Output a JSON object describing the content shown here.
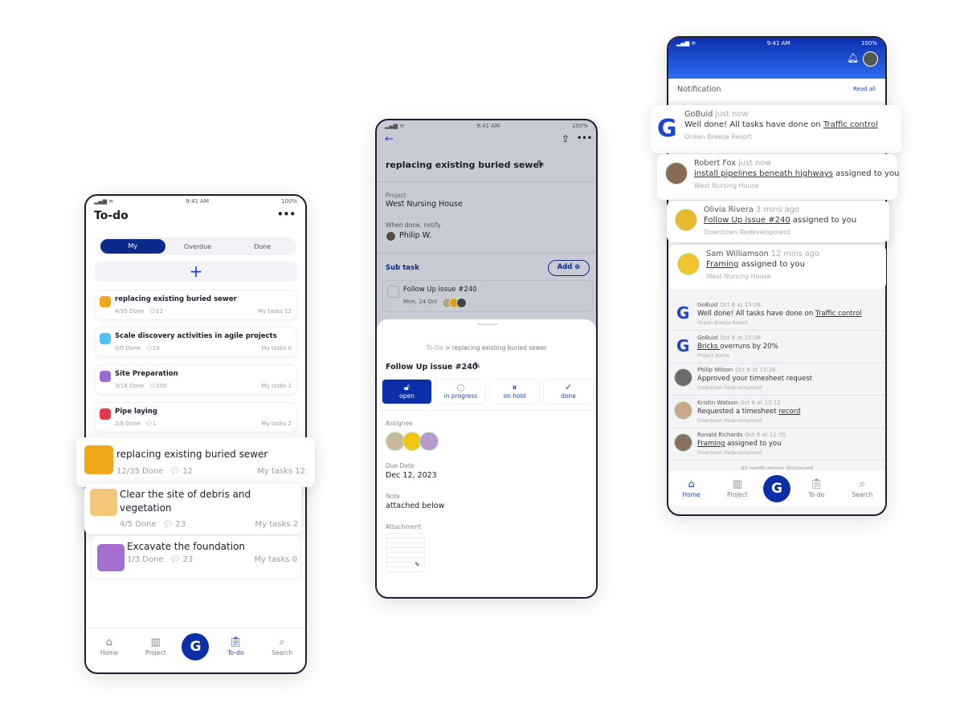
{
  "colors": {
    "primary": "#0a2fa8",
    "accent": "#1f3fd1",
    "header_gradient": [
      "#0d2fb0",
      "#2d6cf0"
    ]
  },
  "status_bar": {
    "time": "9:41 AM",
    "battery": "100%"
  },
  "todo": {
    "title": "To-do",
    "more_icon": "more-horizontal-icon",
    "tabs": [
      "My",
      "Overdue",
      "Done"
    ],
    "add_label": "+",
    "items": [
      {
        "title": "replacing existing buried sewer",
        "done": "4/35 Done",
        "comments": "12",
        "my_tasks": "My tasks 12",
        "icon_color": "#f0a71a"
      },
      {
        "title": "Scale discovery activities in agile projects",
        "done": "0/0 Done",
        "comments": "23",
        "my_tasks": "My tasks 0",
        "icon_color": "#4fc3f7"
      },
      {
        "title": "Site Preparation",
        "done": "3/18 Done",
        "comments": "100",
        "my_tasks": "My tasks 1",
        "icon_color": "#9b6bd6"
      },
      {
        "title": "Pipe laying",
        "done": "2/8 Done",
        "comments": "1",
        "my_tasks": "My tasks 2",
        "icon_color": "#e5384b"
      }
    ],
    "highlight_items": [
      {
        "title": "replacing existing buried sewer",
        "done": "12/35 Done",
        "comments": "12",
        "my_tasks": "My tasks 12",
        "icon_color": "#f0a71a"
      },
      {
        "title": "Clear the site of debris and vegetation",
        "done": "4/5 Done",
        "comments": "23",
        "my_tasks": "My tasks 2",
        "icon_color": "#f2c77a"
      },
      {
        "title": "Excavate the foundation",
        "done": "1/3 Done",
        "comments": "23",
        "my_tasks": "My tasks 0",
        "icon_color": "#a56fd0"
      }
    ],
    "nav": [
      {
        "label": "Home",
        "icon": "home-icon"
      },
      {
        "label": "Project",
        "icon": "project-icon"
      },
      {
        "label": "G",
        "icon": "gobuild-logo"
      },
      {
        "label": "To-do",
        "icon": "todo-clipboard-icon",
        "active": true
      },
      {
        "label": "Search",
        "icon": "search-icon"
      }
    ]
  },
  "detail": {
    "title": "replacing existing buried sewer",
    "project_label": "Project",
    "project": "West Nursing House",
    "notify_label": "When done, notify",
    "notify_person": "Philip W.",
    "subtask_label": "Sub task",
    "add_label": "Add",
    "subtask": {
      "title": "Follow Up issue #240",
      "date": "Mon, 24 Oct"
    },
    "sheet": {
      "breadcrumb_root": "To-Do",
      "breadcrumb_sep": ">",
      "breadcrumb_current": "replacing existing buried sewer",
      "title": "Follow Up issue #240",
      "statuses": [
        {
          "label": "open",
          "icon": "lock-icon",
          "active": true
        },
        {
          "label": "in progress",
          "icon": "progress-icon"
        },
        {
          "label": "on hold",
          "icon": "pause-icon"
        },
        {
          "label": "done",
          "icon": "check-icon"
        }
      ],
      "assignee_label": "Assignee",
      "due_label": "Due Date",
      "due": "Dec 12, 2023",
      "note_label": "Note",
      "note": "attached below",
      "attachment_label": "Attachment"
    }
  },
  "notifications": {
    "header": "Notification",
    "read_all": "Read all",
    "floating": [
      {
        "who": "GoBuid",
        "time": "just now",
        "pre": "Well done! All tasks have done on ",
        "link": "Traffic control",
        "post": "",
        "project": "Ocean Breeze Resort",
        "logo": true
      },
      {
        "who": "Robert Fox",
        "time": "just now",
        "pre": "",
        "link": "install pipelines beneath highways",
        "post": " assigned to you",
        "project": "West Nursing House",
        "avatar": "#8a6a52"
      },
      {
        "who": "Olivia Rivera",
        "time": "3 mins ago",
        "pre": "",
        "link": "Follow Up issue #240",
        "post": " assigned to you",
        "project": "Downtown Redevelopment",
        "avatar": "#e8b92e"
      },
      {
        "who": "Sam Williamson",
        "time": "12 mins ago",
        "pre": "",
        "link": "Framing",
        "post": " assigned to you",
        "project": "West Nursing House",
        "avatar": "#f2c230"
      }
    ],
    "list": [
      {
        "who": "GoBuid",
        "time": "Oct 8 at 15:08",
        "pre": "Well done! All tasks have done on ",
        "link": "Traffic control",
        "post": "",
        "project": "Ocean Breeze Resort",
        "logo": true
      },
      {
        "who": "GoBuid",
        "time": "Oct 8 at 15:08",
        "pre": "",
        "link": "Bricks ",
        "post": "overruns by 20%",
        "project": "Project Name",
        "logo": true
      },
      {
        "who": "Philip Wilson",
        "time": "Oct 8 at 13:28",
        "pre": "Approved your timesheet request",
        "link": "",
        "post": "",
        "project": "Downtown Redevelopment",
        "avatar": "#6b6b6b"
      },
      {
        "who": "Kristin Watson",
        "time": "Oct 8 at 12:12",
        "pre": "Requested a timesheet ",
        "link": "record",
        "post": "",
        "project": "Downtown Redevelopment",
        "avatar": "#c9a98a"
      },
      {
        "who": "Ronald Richards",
        "time": "Oct 8 at 11:35",
        "pre": "",
        "link": "Framing",
        "post": " assigned to you",
        "project": "Downtown Redevelopment",
        "avatar": "#8a7060"
      }
    ],
    "footer": "All notifications displayed",
    "nav": [
      {
        "label": "Home",
        "icon": "home-icon",
        "active": true
      },
      {
        "label": "Project",
        "icon": "project-icon"
      },
      {
        "label": "G",
        "icon": "gobuild-logo"
      },
      {
        "label": "To-do",
        "icon": "todo-clipboard-icon"
      },
      {
        "label": "Search",
        "icon": "search-icon"
      }
    ]
  }
}
